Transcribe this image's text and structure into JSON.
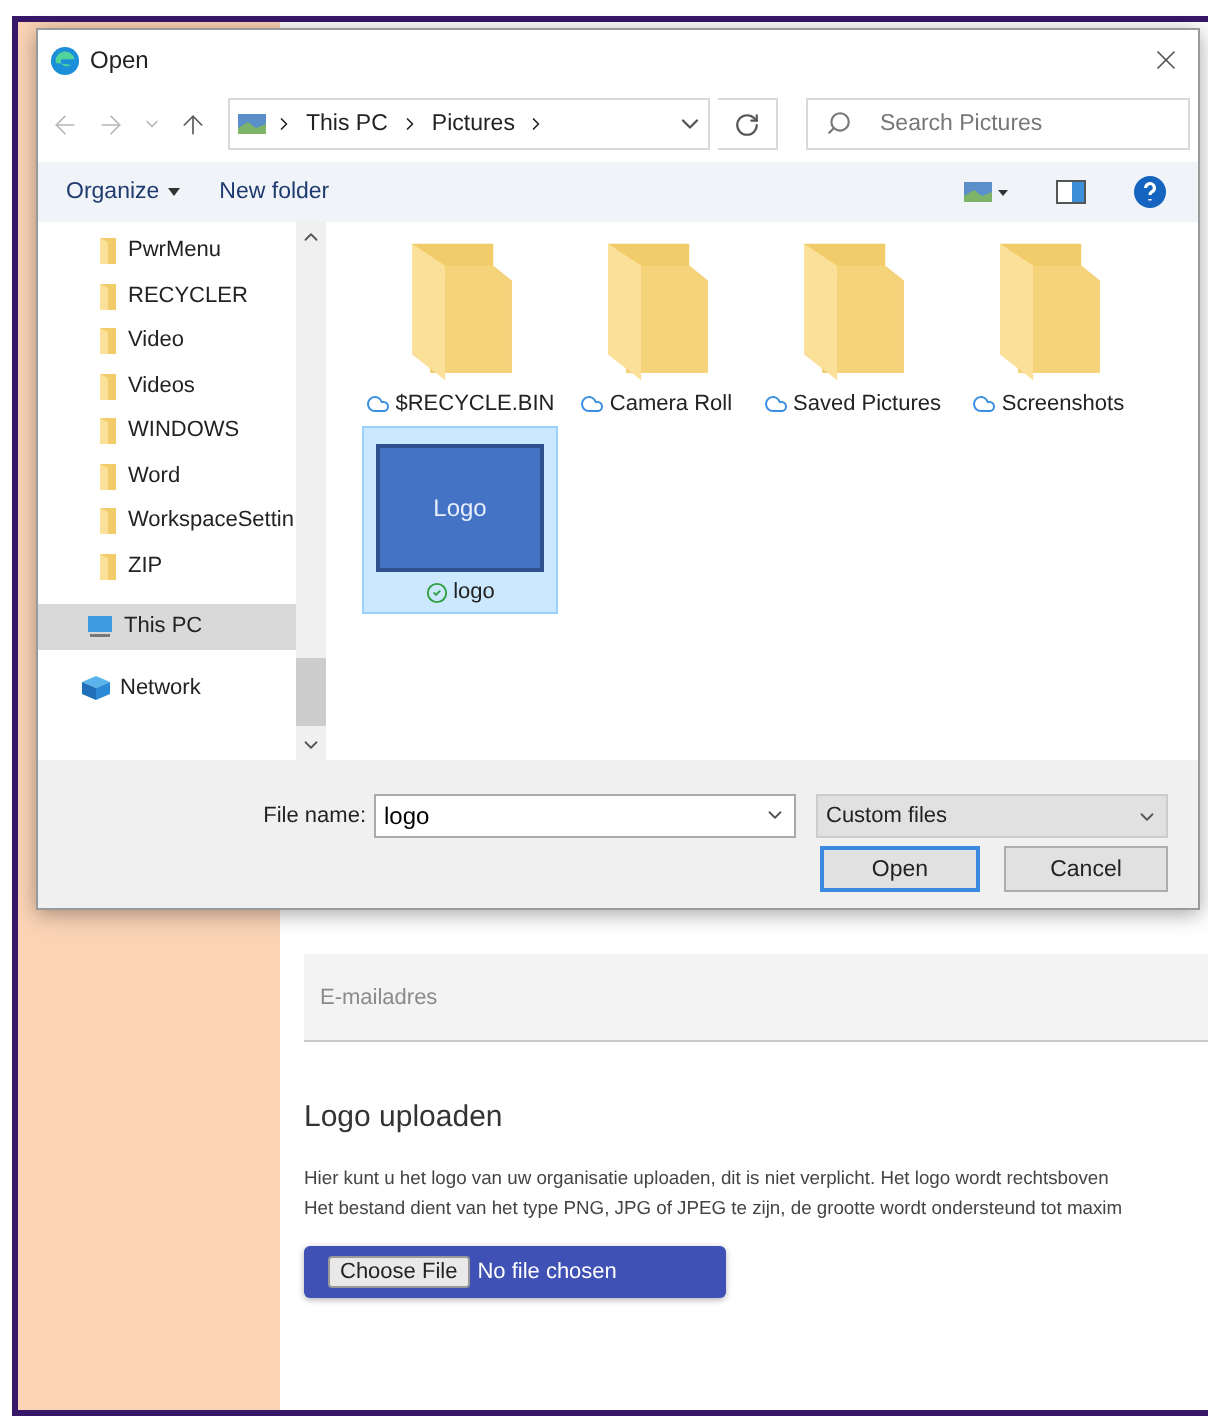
{
  "dialog": {
    "title": "Open",
    "path": [
      "This PC",
      "Pictures"
    ],
    "search": {
      "placeholder": "Search Pictures"
    },
    "toolbar": [
      "Organize",
      "New folder"
    ],
    "nav_items": [
      {
        "label": "PwrMenu",
        "kind": "folder",
        "selected": false
      },
      {
        "label": "RECYCLER",
        "kind": "folder",
        "selected": false
      },
      {
        "label": "Video",
        "kind": "folder",
        "selected": false
      },
      {
        "label": "Videos",
        "kind": "folder",
        "selected": false
      },
      {
        "label": "WINDOWS",
        "kind": "folder",
        "selected": false
      },
      {
        "label": "Word",
        "kind": "folder",
        "selected": false
      },
      {
        "label": "WorkspaceSettin",
        "kind": "folder",
        "selected": false
      },
      {
        "label": "ZIP",
        "kind": "folder",
        "selected": false
      },
      {
        "label": "This PC",
        "kind": "computer",
        "selected": true
      },
      {
        "label": "Network",
        "kind": "network",
        "selected": false
      }
    ],
    "files": [
      {
        "name": "$RECYCLE.BIN",
        "kind": "folder",
        "synced": false,
        "selected": false
      },
      {
        "name": "Camera Roll",
        "kind": "folder",
        "synced": false,
        "selected": false
      },
      {
        "name": "Saved Pictures",
        "kind": "folder",
        "synced": false,
        "selected": false
      },
      {
        "name": "Screenshots",
        "kind": "folder",
        "synced": false,
        "selected": false
      },
      {
        "name": "logo",
        "kind": "image",
        "thumbnail_text": "Logo",
        "synced": true,
        "selected": true
      }
    ],
    "file_name_label": "File name:",
    "file_name": "logo",
    "filter": "Custom files",
    "buttons": [
      {
        "label": "Open",
        "kind": "default"
      },
      {
        "label": "Cancel",
        "kind": "normal"
      }
    ]
  },
  "page": {
    "email_field": {
      "placeholder": "E-mailadres"
    },
    "section_title": "Logo uploaden",
    "description": [
      "Hier kunt u het logo van uw organisatie uploaden, dit is niet verplicht. Het logo wordt rechtsboven",
      "Het bestand dient van het type PNG, JPG of JPEG te zijn, de grootte wordt ondersteund tot maxim"
    ],
    "file_input": {
      "button": "Choose File",
      "status": "No file chosen"
    }
  }
}
